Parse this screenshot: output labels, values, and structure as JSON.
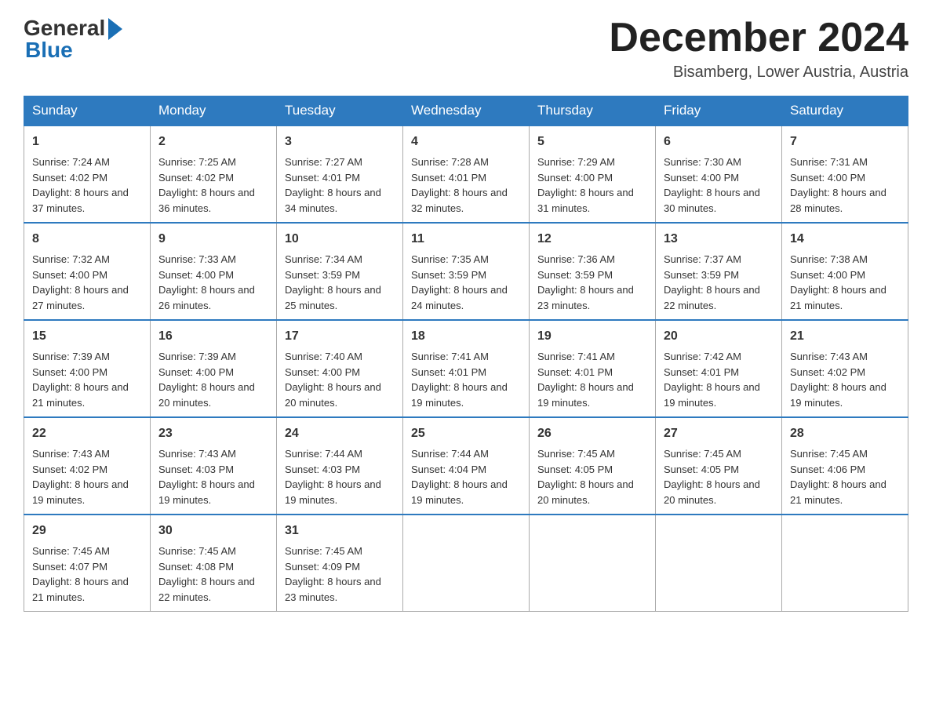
{
  "header": {
    "logo_general": "General",
    "logo_blue": "Blue",
    "month_title": "December 2024",
    "location": "Bisamberg, Lower Austria, Austria"
  },
  "weekdays": [
    "Sunday",
    "Monday",
    "Tuesday",
    "Wednesday",
    "Thursday",
    "Friday",
    "Saturday"
  ],
  "weeks": [
    [
      {
        "day": "1",
        "sunrise": "7:24 AM",
        "sunset": "4:02 PM",
        "daylight": "8 hours and 37 minutes."
      },
      {
        "day": "2",
        "sunrise": "7:25 AM",
        "sunset": "4:02 PM",
        "daylight": "8 hours and 36 minutes."
      },
      {
        "day": "3",
        "sunrise": "7:27 AM",
        "sunset": "4:01 PM",
        "daylight": "8 hours and 34 minutes."
      },
      {
        "day": "4",
        "sunrise": "7:28 AM",
        "sunset": "4:01 PM",
        "daylight": "8 hours and 32 minutes."
      },
      {
        "day": "5",
        "sunrise": "7:29 AM",
        "sunset": "4:00 PM",
        "daylight": "8 hours and 31 minutes."
      },
      {
        "day": "6",
        "sunrise": "7:30 AM",
        "sunset": "4:00 PM",
        "daylight": "8 hours and 30 minutes."
      },
      {
        "day": "7",
        "sunrise": "7:31 AM",
        "sunset": "4:00 PM",
        "daylight": "8 hours and 28 minutes."
      }
    ],
    [
      {
        "day": "8",
        "sunrise": "7:32 AM",
        "sunset": "4:00 PM",
        "daylight": "8 hours and 27 minutes."
      },
      {
        "day": "9",
        "sunrise": "7:33 AM",
        "sunset": "4:00 PM",
        "daylight": "8 hours and 26 minutes."
      },
      {
        "day": "10",
        "sunrise": "7:34 AM",
        "sunset": "3:59 PM",
        "daylight": "8 hours and 25 minutes."
      },
      {
        "day": "11",
        "sunrise": "7:35 AM",
        "sunset": "3:59 PM",
        "daylight": "8 hours and 24 minutes."
      },
      {
        "day": "12",
        "sunrise": "7:36 AM",
        "sunset": "3:59 PM",
        "daylight": "8 hours and 23 minutes."
      },
      {
        "day": "13",
        "sunrise": "7:37 AM",
        "sunset": "3:59 PM",
        "daylight": "8 hours and 22 minutes."
      },
      {
        "day": "14",
        "sunrise": "7:38 AM",
        "sunset": "4:00 PM",
        "daylight": "8 hours and 21 minutes."
      }
    ],
    [
      {
        "day": "15",
        "sunrise": "7:39 AM",
        "sunset": "4:00 PM",
        "daylight": "8 hours and 21 minutes."
      },
      {
        "day": "16",
        "sunrise": "7:39 AM",
        "sunset": "4:00 PM",
        "daylight": "8 hours and 20 minutes."
      },
      {
        "day": "17",
        "sunrise": "7:40 AM",
        "sunset": "4:00 PM",
        "daylight": "8 hours and 20 minutes."
      },
      {
        "day": "18",
        "sunrise": "7:41 AM",
        "sunset": "4:01 PM",
        "daylight": "8 hours and 19 minutes."
      },
      {
        "day": "19",
        "sunrise": "7:41 AM",
        "sunset": "4:01 PM",
        "daylight": "8 hours and 19 minutes."
      },
      {
        "day": "20",
        "sunrise": "7:42 AM",
        "sunset": "4:01 PM",
        "daylight": "8 hours and 19 minutes."
      },
      {
        "day": "21",
        "sunrise": "7:43 AM",
        "sunset": "4:02 PM",
        "daylight": "8 hours and 19 minutes."
      }
    ],
    [
      {
        "day": "22",
        "sunrise": "7:43 AM",
        "sunset": "4:02 PM",
        "daylight": "8 hours and 19 minutes."
      },
      {
        "day": "23",
        "sunrise": "7:43 AM",
        "sunset": "4:03 PM",
        "daylight": "8 hours and 19 minutes."
      },
      {
        "day": "24",
        "sunrise": "7:44 AM",
        "sunset": "4:03 PM",
        "daylight": "8 hours and 19 minutes."
      },
      {
        "day": "25",
        "sunrise": "7:44 AM",
        "sunset": "4:04 PM",
        "daylight": "8 hours and 19 minutes."
      },
      {
        "day": "26",
        "sunrise": "7:45 AM",
        "sunset": "4:05 PM",
        "daylight": "8 hours and 20 minutes."
      },
      {
        "day": "27",
        "sunrise": "7:45 AM",
        "sunset": "4:05 PM",
        "daylight": "8 hours and 20 minutes."
      },
      {
        "day": "28",
        "sunrise": "7:45 AM",
        "sunset": "4:06 PM",
        "daylight": "8 hours and 21 minutes."
      }
    ],
    [
      {
        "day": "29",
        "sunrise": "7:45 AM",
        "sunset": "4:07 PM",
        "daylight": "8 hours and 21 minutes."
      },
      {
        "day": "30",
        "sunrise": "7:45 AM",
        "sunset": "4:08 PM",
        "daylight": "8 hours and 22 minutes."
      },
      {
        "day": "31",
        "sunrise": "7:45 AM",
        "sunset": "4:09 PM",
        "daylight": "8 hours and 23 minutes."
      },
      null,
      null,
      null,
      null
    ]
  ]
}
